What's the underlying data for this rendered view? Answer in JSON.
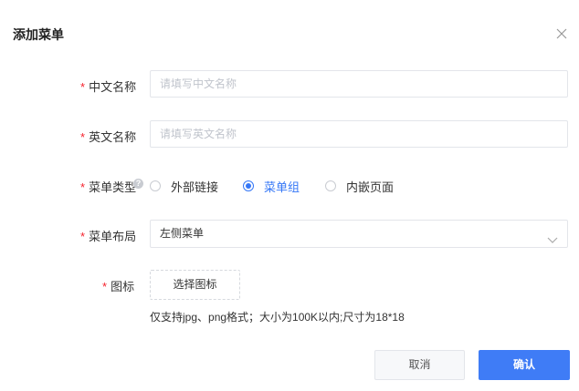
{
  "dialog": {
    "title": "添加菜单"
  },
  "form": {
    "cn_name": {
      "required_mark": "*",
      "label": "中文名称",
      "placeholder": "请填写中文名称",
      "value": ""
    },
    "en_name": {
      "required_mark": "*",
      "label": "英文名称",
      "placeholder": "请填写英文名称",
      "value": ""
    },
    "menu_type": {
      "required_mark": "*",
      "label": "菜单类型",
      "help_icon": "?",
      "options": [
        {
          "label": "外部链接",
          "checked": false
        },
        {
          "label": "菜单组",
          "checked": true
        },
        {
          "label": "内嵌页面",
          "checked": false
        }
      ]
    },
    "menu_layout": {
      "required_mark": "*",
      "label": "菜单布局",
      "selected": "左侧菜单",
      "icon": "chevron-down-icon"
    },
    "icon": {
      "required_mark": "*",
      "label": "图标",
      "upload_label": "选择图标",
      "hint": "仅支持jpg、png格式；大小为100K以内;尺寸为18*18"
    }
  },
  "footer": {
    "cancel_label": "取消",
    "confirm_label": "确认"
  },
  "colors": {
    "accent": "#3f7cf6",
    "required": "#f5222d",
    "border": "#e3e5ea",
    "placeholder": "#c0c4cc"
  },
  "icons": {
    "close": "close-icon"
  }
}
